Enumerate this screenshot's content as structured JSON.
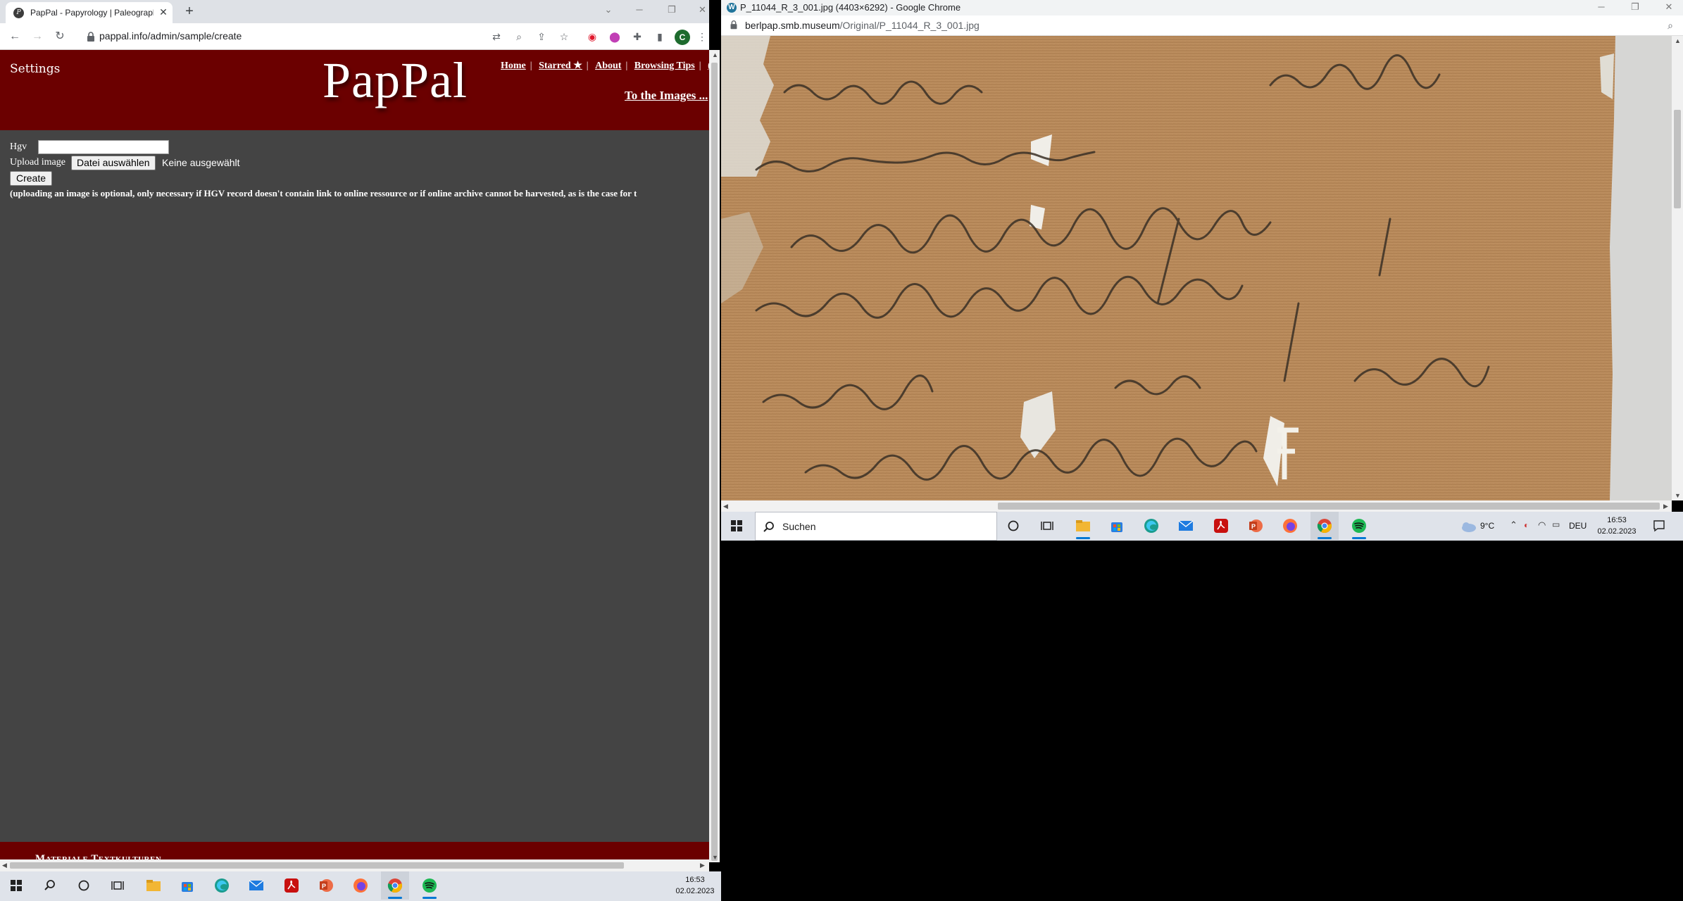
{
  "left_browser": {
    "tab_title": "PapPal - Papyrology | Paleograph",
    "address": "pappal.info/admin/sample/create",
    "profile_initial": "C"
  },
  "site": {
    "settings": "Settings",
    "logo": "PapPal",
    "nav": [
      "Home",
      "Starred ★",
      "About",
      "Browsing Tips"
    ],
    "nav_overflow": "(",
    "to_images": "To the Images ...",
    "form": {
      "hgv_label": "Hgv",
      "hgv_value": "",
      "upload_label": "Upload image",
      "file_button": "Datei auswählen",
      "no_file": "Keine ausgewählt",
      "create_button": "Create",
      "note": "(uploading an image is optional, only necessary if HGV record doesn't contain link to online ressource or if online archive cannot be harvested, as is the case for t"
    },
    "footer": "Materiale Textkulturen"
  },
  "taskbar_left": {
    "time": "16:53",
    "date": "02.02.2023"
  },
  "right_browser": {
    "title": "P_11044_R_3_001.jpg (4403×6292) - Google Chrome",
    "url_host": "berlpap.smb.museum",
    "url_path": "/Original/P_11044_R_3_001.jpg"
  },
  "taskbar_right": {
    "search_placeholder": "Suchen",
    "temperature": "9°C",
    "language": "DEU",
    "time": "16:53",
    "date": "02.02.2023"
  },
  "colors": {
    "site_header": "#6b0000",
    "page_bg": "#444444",
    "papyrus": "#b5885a",
    "taskbar": "#dfe3ea"
  }
}
